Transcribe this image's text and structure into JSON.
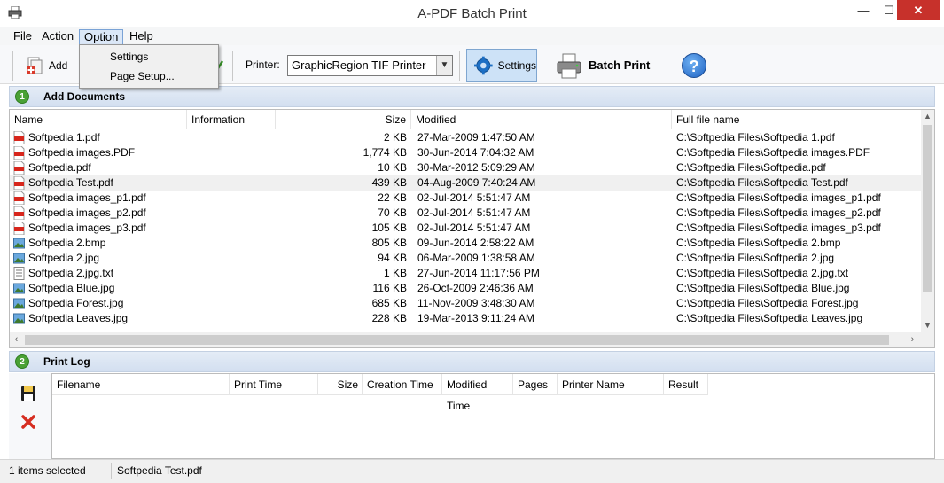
{
  "window": {
    "title": "A-PDF Batch Print",
    "controls": {
      "minimize": "—",
      "maximize": "☐",
      "close": "✕"
    }
  },
  "menu": {
    "items": [
      "File",
      "Action",
      "Option",
      "Help"
    ],
    "active": "Option",
    "dropdown": [
      "Settings",
      "Page Setup..."
    ]
  },
  "toolbar": {
    "add_label": "Add",
    "printer_label": "Printer:",
    "printer_value": "GraphicRegion TIF Printer",
    "settings_label": "Settings",
    "batch_print_label": "Batch Print"
  },
  "sections": {
    "add_documents": {
      "num": "1",
      "label": "Add  Documents"
    },
    "print_log": {
      "num": "2",
      "label": "Print Log"
    }
  },
  "file_table": {
    "columns": [
      "Name",
      "Information",
      "Size",
      "Modified",
      "Full file name"
    ],
    "rows": [
      {
        "icon": "pdf-icon",
        "name": "Softpedia 1.pdf",
        "size": "2 KB",
        "modified": "27-Mar-2009 1:47:50 AM",
        "full": "C:\\Softpedia Files\\Softpedia 1.pdf"
      },
      {
        "icon": "pdf-icon",
        "name": "Softpedia images.PDF",
        "size": "1,774 KB",
        "modified": "30-Jun-2014 7:04:32 AM",
        "full": "C:\\Softpedia Files\\Softpedia images.PDF"
      },
      {
        "icon": "pdf-icon",
        "name": "Softpedia.pdf",
        "size": "10 KB",
        "modified": "30-Mar-2012 5:09:29 AM",
        "full": "C:\\Softpedia Files\\Softpedia.pdf"
      },
      {
        "icon": "pdf-icon",
        "name": "Softpedia Test.pdf",
        "size": "439 KB",
        "modified": "04-Aug-2009 7:40:24 AM",
        "full": "C:\\Softpedia Files\\Softpedia Test.pdf",
        "selected": true
      },
      {
        "icon": "pdf-icon",
        "name": "Softpedia images_p1.pdf",
        "size": "22 KB",
        "modified": "02-Jul-2014 5:51:47 AM",
        "full": "C:\\Softpedia Files\\Softpedia images_p1.pdf"
      },
      {
        "icon": "pdf-icon",
        "name": "Softpedia images_p2.pdf",
        "size": "70 KB",
        "modified": "02-Jul-2014 5:51:47 AM",
        "full": "C:\\Softpedia Files\\Softpedia images_p2.pdf"
      },
      {
        "icon": "pdf-icon",
        "name": "Softpedia images_p3.pdf",
        "size": "105 KB",
        "modified": "02-Jul-2014 5:51:47 AM",
        "full": "C:\\Softpedia Files\\Softpedia images_p3.pdf"
      },
      {
        "icon": "image-icon",
        "name": "Softpedia 2.bmp",
        "size": "805 KB",
        "modified": "09-Jun-2014 2:58:22 AM",
        "full": "C:\\Softpedia Files\\Softpedia 2.bmp"
      },
      {
        "icon": "image-icon",
        "name": "Softpedia 2.jpg",
        "size": "94 KB",
        "modified": "06-Mar-2009 1:38:58 AM",
        "full": "C:\\Softpedia Files\\Softpedia 2.jpg"
      },
      {
        "icon": "text-file-icon",
        "name": "Softpedia 2.jpg.txt",
        "size": "1 KB",
        "modified": "27-Jun-2014 11:17:56 PM",
        "full": "C:\\Softpedia Files\\Softpedia 2.jpg.txt"
      },
      {
        "icon": "image-icon",
        "name": "Softpedia Blue.jpg",
        "size": "116 KB",
        "modified": "26-Oct-2009 2:46:36 AM",
        "full": "C:\\Softpedia Files\\Softpedia Blue.jpg"
      },
      {
        "icon": "image-icon",
        "name": "Softpedia Forest.jpg",
        "size": "685 KB",
        "modified": "11-Nov-2009 3:48:30 AM",
        "full": "C:\\Softpedia Files\\Softpedia Forest.jpg"
      },
      {
        "icon": "image-icon",
        "name": "Softpedia Leaves.jpg",
        "size": "228 KB",
        "modified": "19-Mar-2013 9:11:24 AM",
        "full": "C:\\Softpedia Files\\Softpedia Leaves.jpg"
      }
    ]
  },
  "log_table": {
    "columns": [
      "Filename",
      "Print Time",
      "Size",
      "Creation Time",
      "Modified Time",
      "Pages",
      "Printer Name",
      "Result"
    ]
  },
  "status": {
    "selection": "1 items selected",
    "current_file": "Softpedia Test.pdf"
  },
  "colors": {
    "close_button": "#c7312b",
    "section_header": "#d3dff0",
    "step_badge": "#4aa135",
    "selected_row": "#f0f0f0"
  }
}
